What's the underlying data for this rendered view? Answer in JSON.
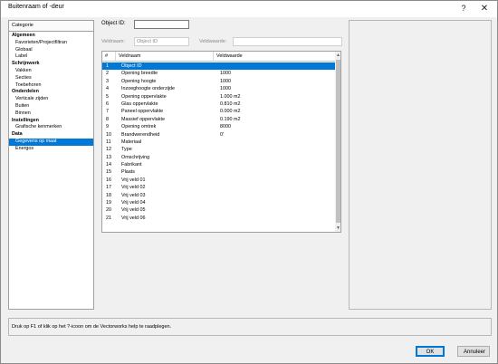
{
  "window": {
    "title": "Buitenraam of -deur",
    "help_glyph": "?",
    "close_glyph": "✕"
  },
  "categories": {
    "header": "Categorie",
    "items": [
      {
        "label": "Algemeen",
        "type": "group"
      },
      {
        "label": "Favorieten/Projectfiltran",
        "type": "sub"
      },
      {
        "label": "Globaal",
        "type": "sub"
      },
      {
        "label": "Label",
        "type": "sub"
      },
      {
        "label": "Schrijnwerk",
        "type": "group"
      },
      {
        "label": "Vakken",
        "type": "sub"
      },
      {
        "label": "Secties",
        "type": "sub"
      },
      {
        "label": "Toebehoren",
        "type": "sub"
      },
      {
        "label": "Onderdelen",
        "type": "group"
      },
      {
        "label": "Verticale zijden",
        "type": "sub"
      },
      {
        "label": "Buiten",
        "type": "sub"
      },
      {
        "label": "Binnen",
        "type": "sub"
      },
      {
        "label": "Instellingen",
        "type": "group"
      },
      {
        "label": "Grafische kenmerken",
        "type": "sub"
      },
      {
        "label": "Data",
        "type": "group"
      },
      {
        "label": "Gegevens op maat",
        "type": "sub",
        "selected": true
      },
      {
        "label": "Energos",
        "type": "sub"
      }
    ]
  },
  "form": {
    "object_id_label": "Object ID:",
    "object_id_value": "",
    "veldnaam_label": "Veldnaam:",
    "veldnaam_placeholder": "Object ID",
    "veldwaarde_label": "Veldwaarde:",
    "veldwaarde_value": ""
  },
  "table": {
    "columns": [
      "#",
      "Veldnaam",
      "Veldwaarde"
    ],
    "rows": [
      {
        "num": "1",
        "name": "Object ID",
        "value": "",
        "selected": true
      },
      {
        "num": "2",
        "name": "Opening breedte",
        "value": "1000"
      },
      {
        "num": "3",
        "name": "Opening hoogte",
        "value": "1000"
      },
      {
        "num": "4",
        "name": "Inzoeghoogte onderzijde",
        "value": "1000"
      },
      {
        "num": "5",
        "name": "Opening oppervlakte",
        "value": "1.000 m2"
      },
      {
        "num": "6",
        "name": "Glas oppervlakte",
        "value": "0.810 m2"
      },
      {
        "num": "7",
        "name": "Paneel oppervlakte",
        "value": "0.000 m2"
      },
      {
        "num": "8",
        "name": "Massief oppervlakte",
        "value": "0.190 m2"
      },
      {
        "num": "9",
        "name": "Opening omtrek",
        "value": "8000"
      },
      {
        "num": "10",
        "name": "Brandwerendheid",
        "value": "0'"
      },
      {
        "num": "11",
        "name": "Materiaal",
        "value": ""
      },
      {
        "num": "12",
        "name": "Type",
        "value": ""
      },
      {
        "num": "13",
        "name": "Omschrijving",
        "value": ""
      },
      {
        "num": "14",
        "name": "Fabrikant",
        "value": ""
      },
      {
        "num": "15",
        "name": "Plaats",
        "value": ""
      },
      {
        "num": "16",
        "name": "Vrij veld 01",
        "value": ""
      },
      {
        "num": "17",
        "name": "Vrij veld 02",
        "value": ""
      },
      {
        "num": "18",
        "name": "Vrij veld 03",
        "value": ""
      },
      {
        "num": "19",
        "name": "Vrij veld 04",
        "value": ""
      },
      {
        "num": "20",
        "name": "Vrij veld 05",
        "value": ""
      },
      {
        "num": "21",
        "name": "Vrij veld 06",
        "value": ""
      }
    ]
  },
  "help_text": "Druk op F1 of klik op het ?-icoon om de Vectorworks help te raadplegen.",
  "buttons": {
    "ok": "OK",
    "cancel": "Annuleer"
  },
  "colors": {
    "selection": "#0078d7"
  }
}
